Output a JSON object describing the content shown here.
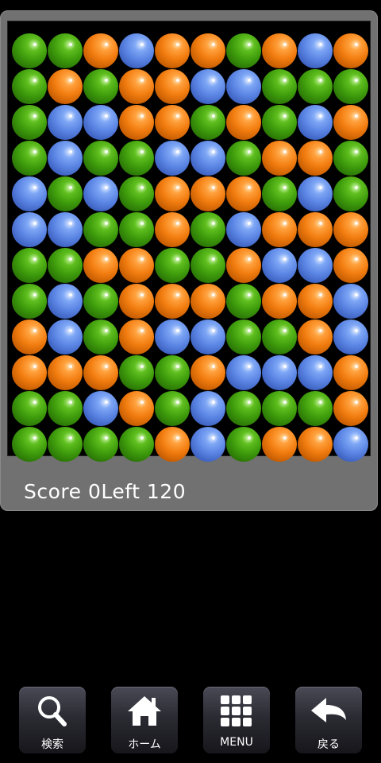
{
  "game": {
    "score_label": "Score",
    "score_value": "0",
    "left_label": "Left",
    "left_value": "120",
    "board": [
      [
        "green",
        "green",
        "orange",
        "blue",
        "orange",
        "orange",
        "green",
        "orange",
        "blue",
        "orange"
      ],
      [
        "green",
        "orange",
        "green",
        "orange",
        "orange",
        "blue",
        "blue",
        "green",
        "green",
        "green"
      ],
      [
        "green",
        "blue",
        "blue",
        "orange",
        "orange",
        "green",
        "orange",
        "green",
        "blue",
        "orange"
      ],
      [
        "green",
        "blue",
        "green",
        "green",
        "blue",
        "blue",
        "green",
        "orange",
        "orange",
        "green"
      ],
      [
        "blue",
        "green",
        "blue",
        "green",
        "orange",
        "orange",
        "orange",
        "green",
        "blue",
        "green"
      ],
      [
        "blue",
        "blue",
        "green",
        "green",
        "orange",
        "green",
        "blue",
        "orange",
        "orange",
        "orange"
      ],
      [
        "green",
        "green",
        "orange",
        "orange",
        "green",
        "green",
        "orange",
        "blue",
        "blue",
        "orange"
      ],
      [
        "green",
        "blue",
        "green",
        "orange",
        "orange",
        "orange",
        "green",
        "orange",
        "orange",
        "blue"
      ],
      [
        "orange",
        "blue",
        "green",
        "orange",
        "blue",
        "blue",
        "green",
        "green",
        "orange",
        "blue"
      ],
      [
        "orange",
        "orange",
        "orange",
        "green",
        "green",
        "orange",
        "blue",
        "blue",
        "blue",
        "orange"
      ],
      [
        "green",
        "green",
        "blue",
        "orange",
        "green",
        "blue",
        "green",
        "green",
        "green",
        "orange"
      ],
      [
        "green",
        "green",
        "green",
        "green",
        "orange",
        "blue",
        "green",
        "orange",
        "orange",
        "blue"
      ]
    ],
    "colors": {
      "orange": "#f27d10",
      "green": "#3e9c0c",
      "blue": "#5a84e3",
      "panel": "#717171"
    }
  },
  "nav": {
    "search_label": "検索",
    "home_label": "ホーム",
    "menu_label": "MENU",
    "back_label": "戻る"
  }
}
